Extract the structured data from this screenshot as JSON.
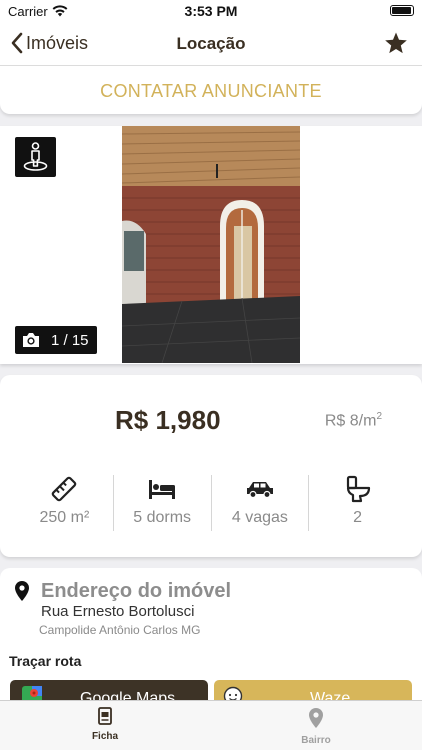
{
  "status": {
    "carrier": "Carrier",
    "time": "3:53 PM"
  },
  "nav": {
    "back_label": "Imóveis",
    "title": "Locação"
  },
  "contact": {
    "label": "CONTATAR ANUNCIANTE"
  },
  "media": {
    "photo_counter": "1 / 15",
    "current_photo": 1,
    "total_photos": 15
  },
  "pricing": {
    "price": "R$ 1,980",
    "price_per_m2": "R$ 8/m",
    "price_per_m2_sup": "2"
  },
  "features": [
    {
      "icon": "ruler-icon",
      "label": "250 m²"
    },
    {
      "icon": "bed-icon",
      "label": "5 dorms"
    },
    {
      "icon": "car-icon",
      "label": "4 vagas"
    },
    {
      "icon": "toilet-icon",
      "label": "2"
    }
  ],
  "address": {
    "title": "Endereço do imóvel",
    "street": "Rua Ernesto Bortolusci",
    "city": "Campolide Antônio Carlos MG",
    "route_label": "Traçar rota",
    "maps_button": "Google Maps",
    "waze_button": "Waze"
  },
  "tabs": [
    {
      "label": "Ficha",
      "active": true
    },
    {
      "label": "Bairro",
      "active": false
    }
  ],
  "colors": {
    "brand_dark": "#3a2f22",
    "brand_gold": "#d2b25a",
    "muted": "#8a8a8a"
  }
}
